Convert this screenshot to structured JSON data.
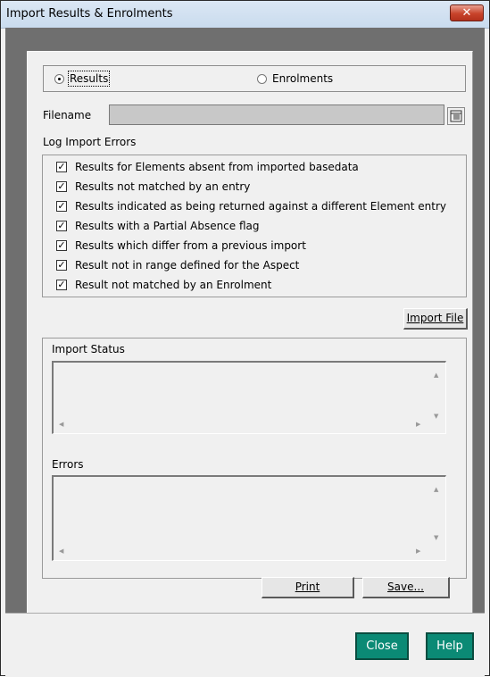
{
  "window": {
    "title": "Import Results & Enrolments",
    "close_glyph": "✕"
  },
  "mode": {
    "options": [
      {
        "label": "Results",
        "selected": true
      },
      {
        "label": "Enrolments",
        "selected": false
      }
    ]
  },
  "filename": {
    "label": "Filename",
    "value": "",
    "browse_icon": "browse-folder-icon"
  },
  "log_errors": {
    "heading": "Log Import Errors",
    "items": [
      {
        "label": "Results for Elements absent from imported basedata",
        "checked": true
      },
      {
        "label": "Results not matched by an entry",
        "checked": true
      },
      {
        "label": "Results indicated as being returned against a different Element entry",
        "checked": true
      },
      {
        "label": "Results with a Partial Absence flag",
        "checked": true
      },
      {
        "label": "Results which differ from a previous import",
        "checked": true
      },
      {
        "label": "Result not in range defined for the Aspect",
        "checked": true
      },
      {
        "label": "Result not matched by an Enrolment",
        "checked": true
      }
    ]
  },
  "import_button": {
    "label": "Import File"
  },
  "import_status": {
    "label": "Import Status",
    "value": ""
  },
  "errors": {
    "label": "Errors",
    "value": ""
  },
  "print_button": {
    "label": "Print"
  },
  "save_button": {
    "label": "Save..."
  },
  "footer": {
    "close_label": "Close",
    "help_label": "Help",
    "button_color": "#0b8a75"
  }
}
